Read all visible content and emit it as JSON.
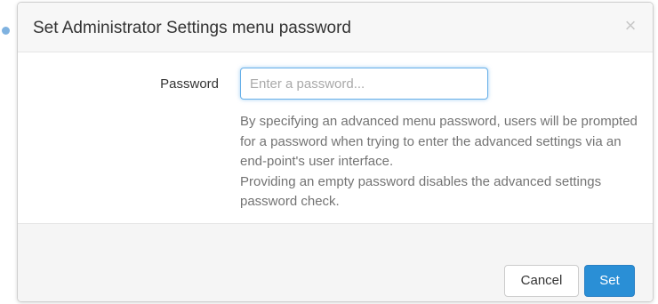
{
  "dialog": {
    "title": "Set Administrator Settings menu password",
    "close_glyph": "×"
  },
  "form": {
    "password_label": "Password",
    "password_placeholder": "Enter a password...",
    "password_value": "",
    "help_line1": "By specifying an advanced menu password, users will be prompted for a password when trying to enter the advanced settings via an end-point's user interface.",
    "help_line2": "Providing an empty password disables the advanced settings password check."
  },
  "footer": {
    "cancel_label": "Cancel",
    "set_label": "Set"
  },
  "colors": {
    "primary": "#2a8fd6",
    "focus_border": "#66afe9",
    "footer_bg": "#f5f5f5"
  },
  "icons": {
    "close": "close-icon"
  }
}
